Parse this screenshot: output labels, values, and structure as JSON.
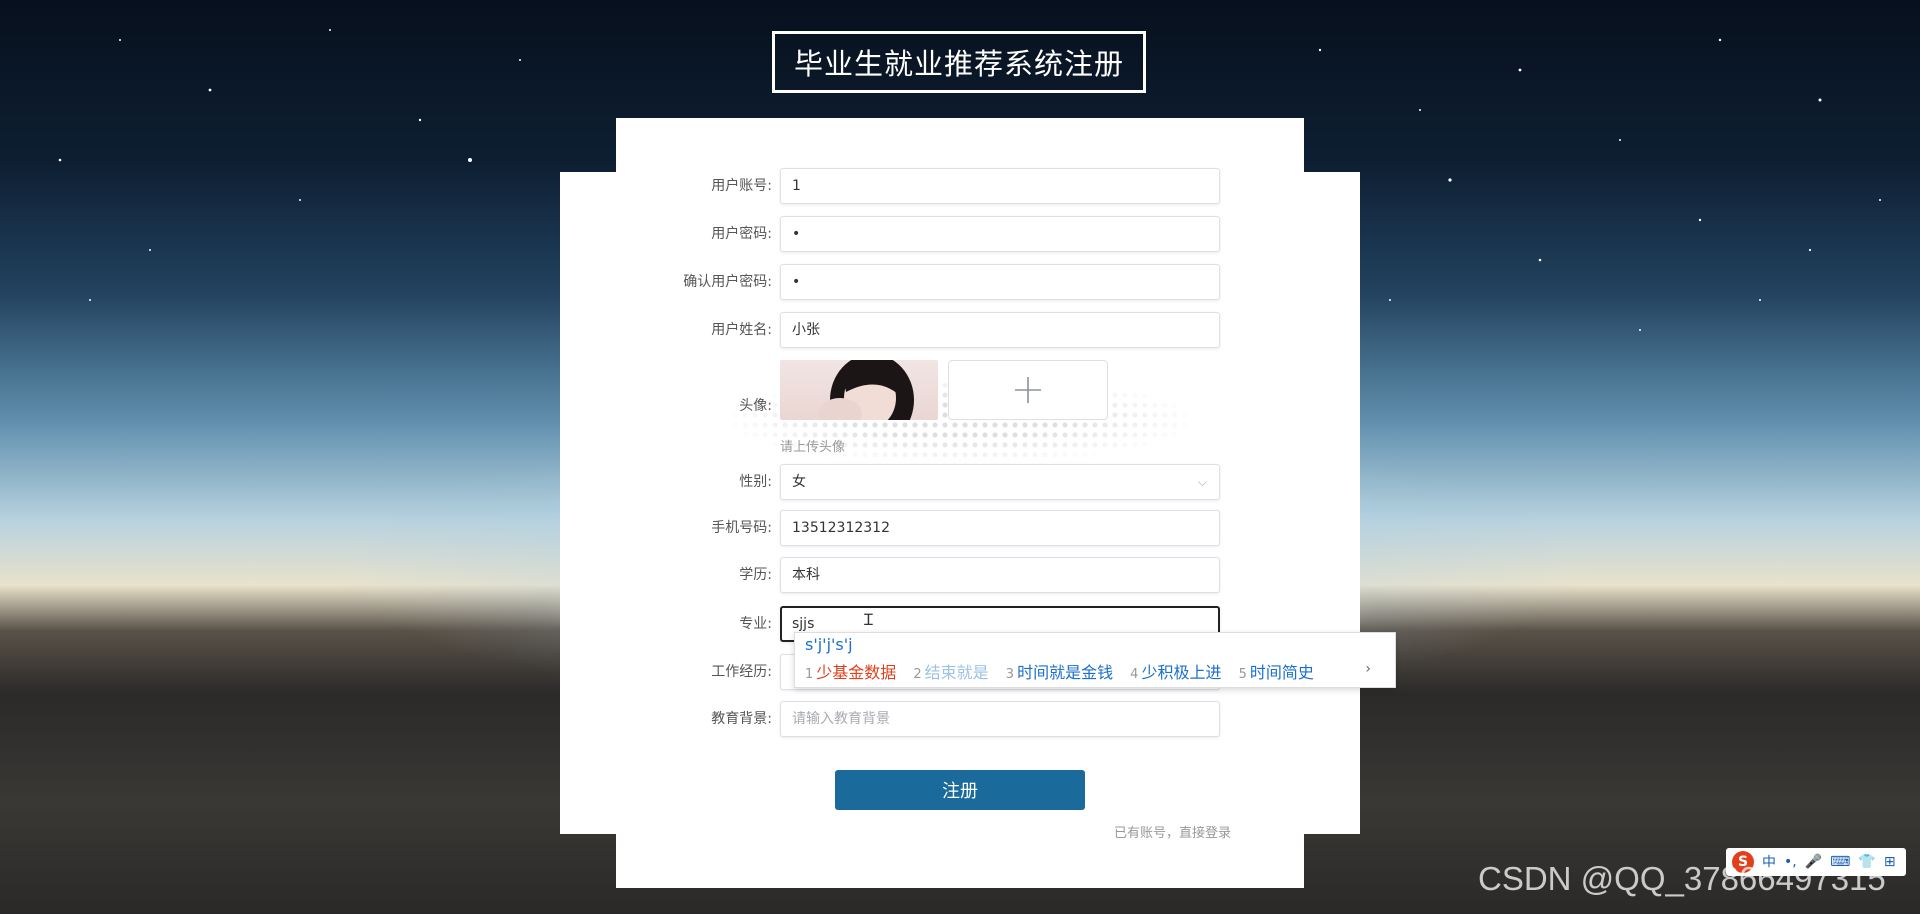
{
  "page": {
    "title": "毕业生就业推荐系统注册"
  },
  "form": {
    "account": {
      "label": "用户账号:",
      "value": "1"
    },
    "password": {
      "label": "用户密码:",
      "value": "•"
    },
    "confirm_password": {
      "label": "确认用户密码:",
      "value": "•"
    },
    "name": {
      "label": "用户姓名:",
      "value": "小张"
    },
    "avatar": {
      "label": "头像:",
      "hint": "请上传头像"
    },
    "gender": {
      "label": "性别:",
      "value": "女"
    },
    "phone": {
      "label": "手机号码:",
      "value": "13512312312"
    },
    "education": {
      "label": "学历:",
      "value": "本科"
    },
    "major": {
      "label": "专业:",
      "value": "sjjs"
    },
    "work_experience": {
      "label": "工作经历:",
      "value": ""
    },
    "edu_background": {
      "label": "教育背景:",
      "placeholder": "请输入教育背景"
    },
    "submit_label": "注册",
    "login_link": "已有账号，直接登录"
  },
  "ime": {
    "composition": "s'j'j's'j",
    "candidates": [
      {
        "n": "1",
        "text": "少基金数据"
      },
      {
        "n": "2",
        "text": "结束就是"
      },
      {
        "n": "3",
        "text": "时间就是金钱"
      },
      {
        "n": "4",
        "text": "少积极上进"
      },
      {
        "n": "5",
        "text": "时间简史"
      }
    ],
    "next": "›",
    "toolbar": [
      "S",
      "中",
      "•,",
      "🎤",
      "⌨",
      "👕",
      "⊞"
    ]
  },
  "watermark": "CSDN @QQ_37866497315"
}
